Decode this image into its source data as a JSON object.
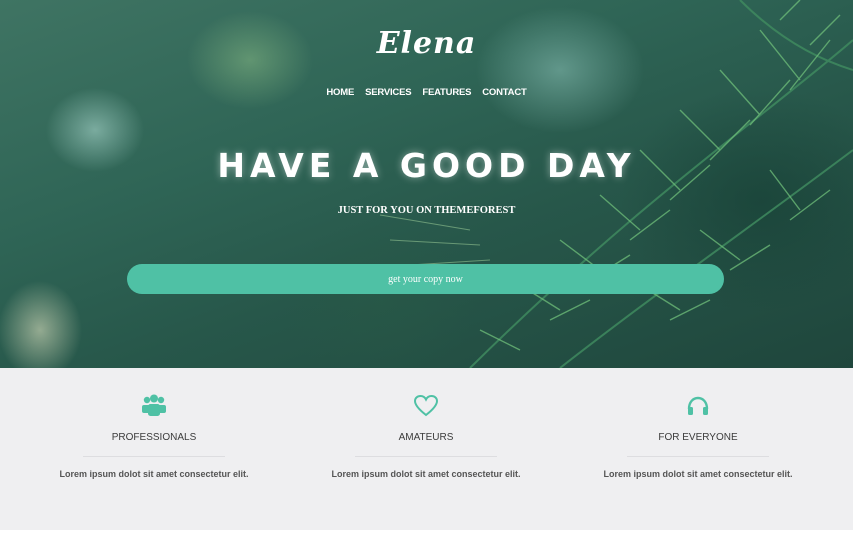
{
  "brand": {
    "logo": "Elena"
  },
  "nav": {
    "items": [
      "HOME",
      "SERVICES",
      "FEATURES",
      "CONTACT"
    ]
  },
  "hero": {
    "headline": "HAVE A GOOD DAY",
    "subheadline": "JUST FOR YOU ON THEMEFOREST",
    "cta_label": "get your copy now"
  },
  "features": [
    {
      "icon": "users-icon",
      "title": "PROFESSIONALS",
      "description": "Lorem ipsum dolot sit amet consectetur elit."
    },
    {
      "icon": "heart-icon",
      "title": "AMATEURS",
      "description": "Lorem ipsum dolot sit amet consectetur elit."
    },
    {
      "icon": "headphones-icon",
      "title": "FOR EVERYONE",
      "description": "Lorem ipsum dolot sit amet consectetur elit."
    }
  ],
  "colors": {
    "accent": "#4fc1a5",
    "features_bg": "#efeff1",
    "text_dark": "#3b3b3b"
  }
}
